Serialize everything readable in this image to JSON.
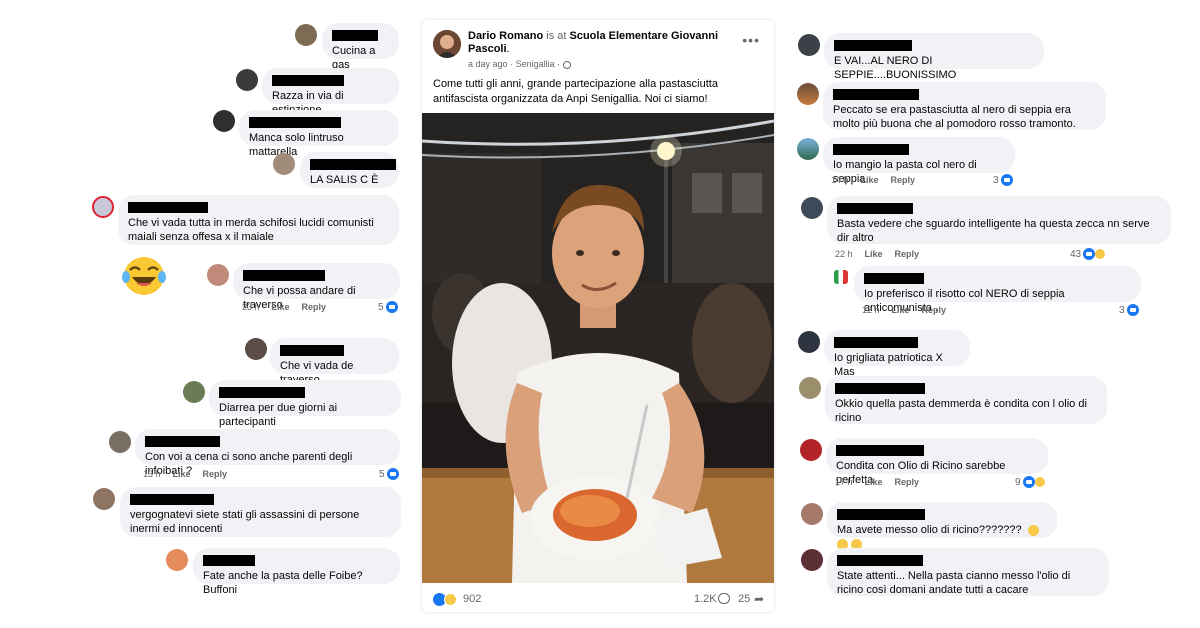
{
  "post": {
    "author": "Dario Romano",
    "is_at": "is at",
    "place": "Scuola Elementare Giovanni Pascoli",
    "time": "a day ago",
    "location": "Senigallia",
    "text": "Come tutti gli anni,  grande partecipazione alla pastasciutta antifascista organizzata da Anpi Senigallia. Noi ci siamo!",
    "reactions_count": "902",
    "comments_count": "1.2K",
    "shares_count": "25"
  },
  "left_comments": [
    {
      "text": "Cucina a gas"
    },
    {
      "text": "Razza in via di estinzione"
    },
    {
      "text": "Manca solo lintruso mattarella"
    },
    {
      "text": "LA SALIS C È"
    },
    {
      "text": "Che vi vada tutta in merda schifosi lucidi comunisti maiali senza offesa x il maiale"
    },
    {
      "text": "Che vi possa andare di traverso",
      "time": "23 h",
      "like": "Like",
      "reply": "Reply",
      "reactions": "5"
    },
    {
      "text": "Che vi vada de traverso"
    },
    {
      "text": "Diarrea per due giorni ai partecipanti"
    },
    {
      "text": "Con voi a cena ci sono anche parenti degli infoibati ?",
      "time": "13 h",
      "like": "Like",
      "reply": "Reply",
      "reactions": "5"
    },
    {
      "text": "vergognatevi siete stati gli assassini di persone inermi ed innocenti"
    },
    {
      "text": "Fate anche la pasta delle Foibe? Buffoni"
    }
  ],
  "right_comments": [
    {
      "text": "E VAI...AL NERO DI SEPPIE....BUONISSIMO"
    },
    {
      "text": "Peccato se era pastasciutta al nero di seppia era molto più buona che al pomodoro rosso tramonto."
    },
    {
      "text": "Io mangio la pasta col nero di seppia.",
      "time": "14 h",
      "like": "Like",
      "reply": "Reply",
      "reactions": "3"
    },
    {
      "text": "Basta vedere che sguardo intelligente ha questa zecca nn serve dir altro",
      "time": "22 h",
      "like": "Like",
      "reply": "Reply",
      "reactions": "43"
    },
    {
      "text": "Io preferisco il risotto col NERO di seppia anticomunista .",
      "time": "12 h",
      "like": "Like",
      "reply": "Reply",
      "reactions": "3"
    },
    {
      "text": "Io grigliata patriotica X Mas"
    },
    {
      "text": "Okkio quella pasta demmerda è condita con l olio di ricino"
    },
    {
      "text": "Condita con Olio di Ricino sarebbe perfetta",
      "time": "17 h",
      "like": "Like",
      "reply": "Reply",
      "reactions": "9"
    },
    {
      "text": "Ma avete messo olio di ricino???????"
    },
    {
      "text": "State attenti... Nella pasta cianno messo l'olio di ricino così domani andate tutti a cacare"
    }
  ],
  "icons": [
    "more-icon",
    "globe-icon",
    "like-icon",
    "haha-icon",
    "comment-icon",
    "share-icon",
    "laughing-emoji"
  ],
  "colors": {
    "bubble": "#f0f2f5",
    "like_blue": "#1877f2",
    "meta_gray": "#65676b"
  }
}
